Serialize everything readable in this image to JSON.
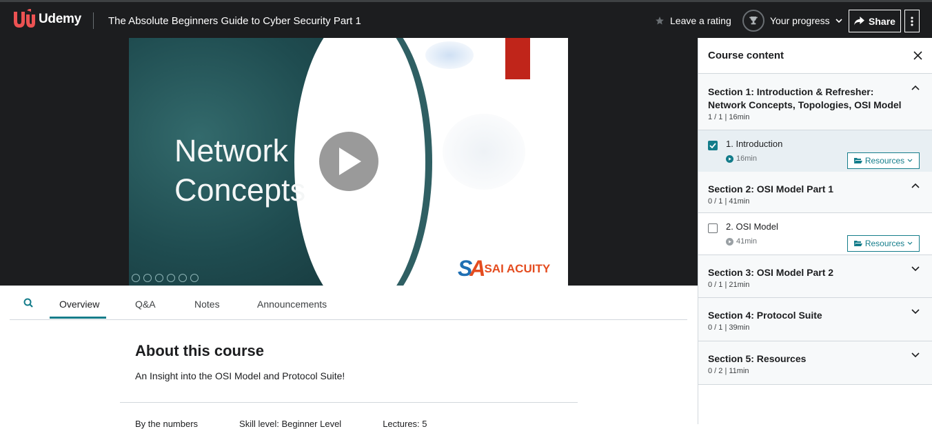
{
  "header": {
    "brand": "Udemy",
    "course_title": "The Absolute Beginners Guide to Cyber Security Part 1",
    "rating_label": "Leave a rating",
    "progress_label": "Your progress",
    "share_label": "Share"
  },
  "video": {
    "slide_title_line1": "Network",
    "slide_title_line2": "Concepts",
    "logo_text": "SAI ACUITY"
  },
  "tabs": [
    "Overview",
    "Q&A",
    "Notes",
    "Announcements"
  ],
  "about": {
    "heading": "About this course",
    "description": "An Insight into the OSI Model and Protocol Suite!",
    "stats": [
      "By the numbers",
      "Skill level: Beginner Level",
      "Lectures: 5"
    ]
  },
  "sidebar": {
    "title": "Course content",
    "resources_label": "Resources",
    "sections": [
      {
        "title": "Section 1: Introduction & Refresher: Network Concepts, Topologies, OSI Model ...",
        "meta": "1 / 1 | 16min",
        "expanded": true,
        "items": [
          {
            "title": "1. Introduction",
            "duration": "16min",
            "checked": true
          }
        ]
      },
      {
        "title": "Section 2: OSI Model Part 1",
        "meta": "0 / 1 | 41min",
        "expanded": true,
        "items": [
          {
            "title": "2. OSI Model",
            "duration": "41min",
            "checked": false
          }
        ]
      },
      {
        "title": "Section 3: OSI Model Part 2",
        "meta": "0 / 1 | 21min",
        "expanded": false
      },
      {
        "title": "Section 4: Protocol Suite",
        "meta": "0 / 1 | 39min",
        "expanded": false
      },
      {
        "title": "Section 5: Resources",
        "meta": "0 / 2 | 11min",
        "expanded": false
      }
    ]
  },
  "colors": {
    "accent": "#137c8a",
    "brand": "#a435f0",
    "header_bg": "#1c1d1f",
    "logo_red": "#ec5252"
  }
}
